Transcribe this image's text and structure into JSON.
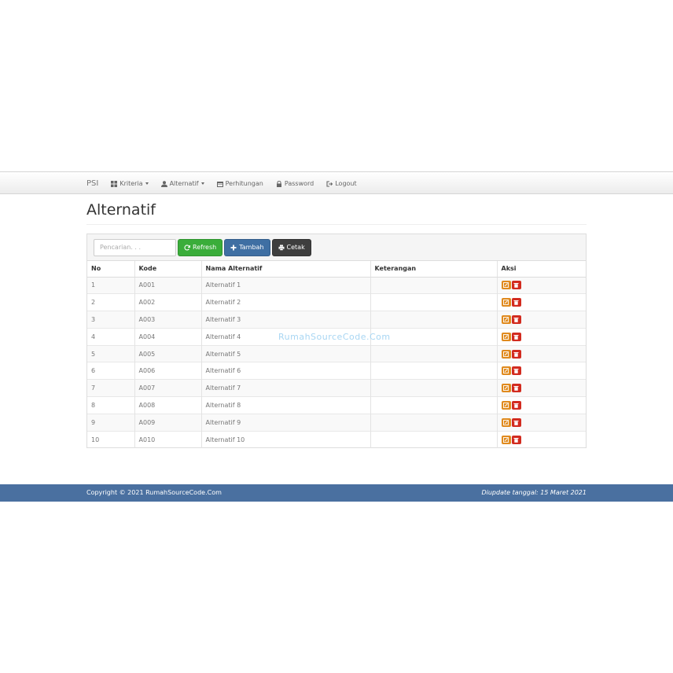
{
  "navbar": {
    "brand": "PSI",
    "items": [
      {
        "label": "Kriteria",
        "icon": "grid-icon",
        "dropdown": true
      },
      {
        "label": "Alternatif",
        "icon": "user-icon",
        "dropdown": true
      },
      {
        "label": "Perhitungan",
        "icon": "calendar-icon",
        "dropdown": false
      },
      {
        "label": "Password",
        "icon": "lock-icon",
        "dropdown": false
      },
      {
        "label": "Logout",
        "icon": "logout-icon",
        "dropdown": false
      }
    ]
  },
  "page": {
    "title": "Alternatif"
  },
  "toolbar": {
    "search_placeholder": "Pencarian. . .",
    "refresh_label": "Refresh",
    "add_label": "Tambah",
    "print_label": "Cetak"
  },
  "table": {
    "headers": [
      "No",
      "Kode",
      "Nama Alternatif",
      "Keterangan",
      "Aksi"
    ],
    "rows": [
      {
        "no": "1",
        "kode": "A001",
        "nama": "Alternatif 1",
        "keterangan": ""
      },
      {
        "no": "2",
        "kode": "A002",
        "nama": "Alternatif 2",
        "keterangan": ""
      },
      {
        "no": "3",
        "kode": "A003",
        "nama": "Alternatif 3",
        "keterangan": ""
      },
      {
        "no": "4",
        "kode": "A004",
        "nama": "Alternatif 4",
        "keterangan": ""
      },
      {
        "no": "5",
        "kode": "A005",
        "nama": "Alternatif 5",
        "keterangan": ""
      },
      {
        "no": "6",
        "kode": "A006",
        "nama": "Alternatif 6",
        "keterangan": ""
      },
      {
        "no": "7",
        "kode": "A007",
        "nama": "Alternatif 7",
        "keterangan": ""
      },
      {
        "no": "8",
        "kode": "A008",
        "nama": "Alternatif 8",
        "keterangan": ""
      },
      {
        "no": "9",
        "kode": "A009",
        "nama": "Alternatif 9",
        "keterangan": ""
      },
      {
        "no": "10",
        "kode": "A010",
        "nama": "Alternatif 10",
        "keterangan": ""
      }
    ]
  },
  "watermark": "RumahSourceCode.Com",
  "footer": {
    "copyright": "Copyright © 2021 RumahSourceCode.Com",
    "updated": "Diupdate tanggal: 15 Maret 2021"
  },
  "colors": {
    "refresh": "#3aad3a",
    "add": "#3f6fa3",
    "print": "#3e3e3e",
    "edit": "#e08a1e",
    "delete": "#d22b1f",
    "footer": "#4a70a0"
  }
}
